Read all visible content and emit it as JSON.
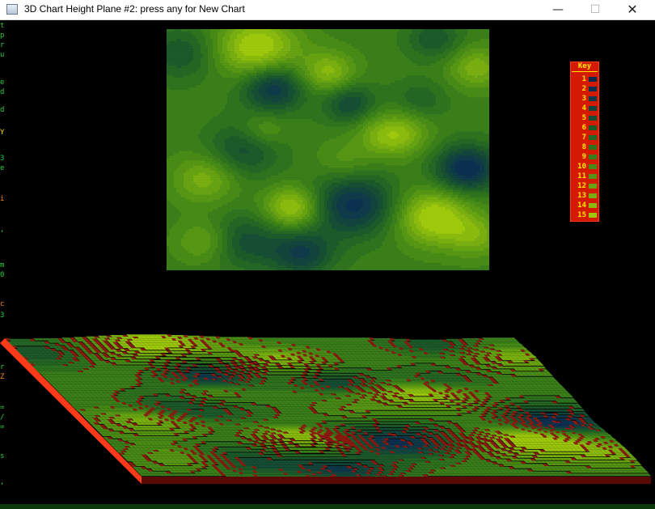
{
  "window": {
    "title": "3D Chart Height Plane #2: press any for New Chart",
    "icon": "app-window-icon",
    "minimize_glyph": "—",
    "maximize_glyph": "☐",
    "close_glyph": "✕"
  },
  "legend": {
    "title": "Key",
    "items": [
      {
        "label": "1",
        "color": "#0a2a4a"
      },
      {
        "label": "2",
        "color": "#0c3050"
      },
      {
        "label": "3",
        "color": "#0e3a4a"
      },
      {
        "label": "4",
        "color": "#12443c"
      },
      {
        "label": "5",
        "color": "#164e34"
      },
      {
        "label": "6",
        "color": "#1c5a2a"
      },
      {
        "label": "7",
        "color": "#246624"
      },
      {
        "label": "8",
        "color": "#2e721e"
      },
      {
        "label": "9",
        "color": "#3a7e1a"
      },
      {
        "label": "10",
        "color": "#488a16"
      },
      {
        "label": "11",
        "color": "#569614"
      },
      {
        "label": "12",
        "color": "#66a212"
      },
      {
        "label": "13",
        "color": "#78ae10"
      },
      {
        "label": "14",
        "color": "#8aba0e"
      },
      {
        "label": "15",
        "color": "#9ec80c"
      }
    ]
  },
  "colors": {
    "background": "#000000",
    "legend_bg": "#d41a00",
    "legend_text": "#ffe600",
    "contour_line": "#8a1a10",
    "plane_side": "#ff3a1a",
    "plane_front": "#5a0a05"
  },
  "background_console_glyphs": [
    {
      "ch": "t",
      "color": "#2ecc40"
    },
    {
      "ch": "p",
      "color": "#2ecc40"
    },
    {
      "ch": "r",
      "color": "#2ecc40"
    },
    {
      "ch": "u",
      "color": "#2ecc40"
    },
    {
      "ch": "e",
      "color": "#2ecc40"
    },
    {
      "ch": "d",
      "color": "#2ecc40"
    },
    {
      "ch": "d",
      "color": "#2ecc40"
    },
    {
      "ch": "Y",
      "color": "#ffdc00"
    },
    {
      "ch": "3",
      "color": "#2ecc40"
    },
    {
      "ch": "e",
      "color": "#2ecc40"
    },
    {
      "ch": "i",
      "color": "#ff851b"
    },
    {
      "ch": ",",
      "color": "#2ecc40"
    },
    {
      "ch": "m",
      "color": "#2ecc40"
    },
    {
      "ch": "0",
      "color": "#2ecc40"
    },
    {
      "ch": "c",
      "color": "#ff851b"
    },
    {
      "ch": "3",
      "color": "#2ecc40"
    },
    {
      "ch": "r",
      "color": "#2ecc40"
    },
    {
      "ch": "Z",
      "color": "#ff851b"
    },
    {
      "ch": "=",
      "color": "#2ecc40"
    },
    {
      "ch": "/",
      "color": "#2ecc40"
    },
    {
      "ch": "=",
      "color": "#2ecc40"
    },
    {
      "ch": "s",
      "color": "#2ecc40"
    },
    {
      "ch": ",",
      "color": "#2ecc40"
    }
  ]
}
